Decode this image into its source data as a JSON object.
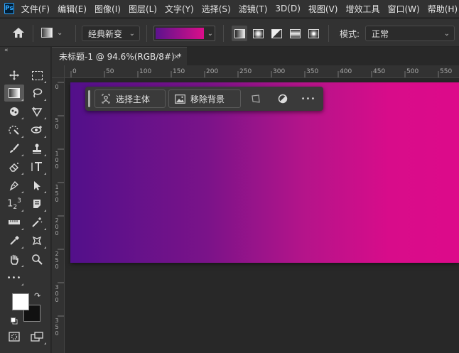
{
  "app": {
    "logo_text": "Ps"
  },
  "menu": [
    "文件(F)",
    "编辑(E)",
    "图像(I)",
    "图层(L)",
    "文字(Y)",
    "选择(S)",
    "滤镜(T)",
    "3D(D)",
    "视图(V)",
    "增效工具",
    "窗口(W)",
    "帮助(H)"
  ],
  "options": {
    "preset_label": "经典新变",
    "gradient_colors": [
      "#5b138d",
      "#db0e8a"
    ],
    "mode_label": "模式:",
    "mode_value": "正常"
  },
  "tab": {
    "title": "未标题-1 @ 94.6%(RGB/8#) *",
    "close": "×"
  },
  "ruler": {
    "top_labels": [
      "0",
      "50",
      "100",
      "150",
      "200",
      "250",
      "300",
      "350",
      "400",
      "450",
      "500",
      "550"
    ],
    "left_labels": [
      "0",
      "50",
      "100",
      "150",
      "200",
      "250",
      "300",
      "350"
    ]
  },
  "context_bar": {
    "select_subject": "选择主体",
    "remove_background": "移除背景",
    "more": "•••"
  },
  "toolbar": {
    "more": "•••"
  },
  "colors": {
    "foreground": "#ffffff",
    "background": "#111111",
    "accent": "#31a8ff"
  }
}
